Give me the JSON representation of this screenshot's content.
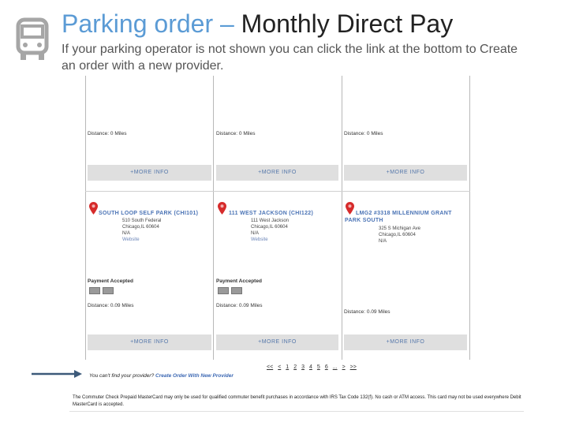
{
  "header": {
    "title_part1": "Parking order – ",
    "title_part2": "Monthly Direct Pay",
    "subtitle": "If your parking operator is not shown you can click the link at the bottom to Create an order with a new provider."
  },
  "colors": {
    "accent_blue": "#5b9bd5",
    "pin_red": "#d62b2b",
    "link_blue": "#4a73b5",
    "button_gray": "#dfdfdf"
  },
  "top_row": [
    {
      "distance": "Distance: 0 Miles",
      "more_info": "+MORE INFO"
    },
    {
      "distance": "Distance: 0 Miles",
      "more_info": "+MORE INFO"
    },
    {
      "distance": "Distance: 0 Miles",
      "more_info": "+MORE INFO"
    }
  ],
  "bottom_row": [
    {
      "title": "SOUTH LOOP SELF PARK (CHI101)",
      "addr1": "510 South Federal",
      "addr2": "Chicago,IL 60604",
      "addr3": "N/A",
      "addr4": "Website",
      "payment_label": "Payment Accepted",
      "distance": "Distance: 0.09 Miles",
      "more_info": "+MORE INFO"
    },
    {
      "title": "111 WEST JACKSON (CHI122)",
      "addr1": "111 West Jackson",
      "addr2": "Chicago,IL 60604",
      "addr3": "N/A",
      "addr4": "Website",
      "payment_label": "Payment Accepted",
      "distance": "Distance: 0.09 Miles",
      "more_info": "+MORE INFO"
    },
    {
      "title": "LMG2 #3318 MILLENNIUM GRANT PARK SOUTH",
      "addr1": "325 S Michigan Ave",
      "addr2": "Chicago,IL 60604",
      "addr3": "N/A",
      "distance": "Distance: 0.09 Miles",
      "more_info": "+MORE INFO"
    }
  ],
  "pagination": [
    "<<",
    "<",
    "1",
    "2",
    "3",
    "4",
    "5",
    "6",
    "...",
    ">",
    ">>"
  ],
  "no_provider": {
    "text": "You can't find your provider? ",
    "link": "Create Order With New Provider"
  },
  "disclaimer": "The Commuter Check Prepaid MasterCard may only be used for qualified commuter benefit purchases in accordance with IRS Tax Code 132(f). No cash or ATM access. This card may not be used everywhere Debit MasterCard is accepted."
}
